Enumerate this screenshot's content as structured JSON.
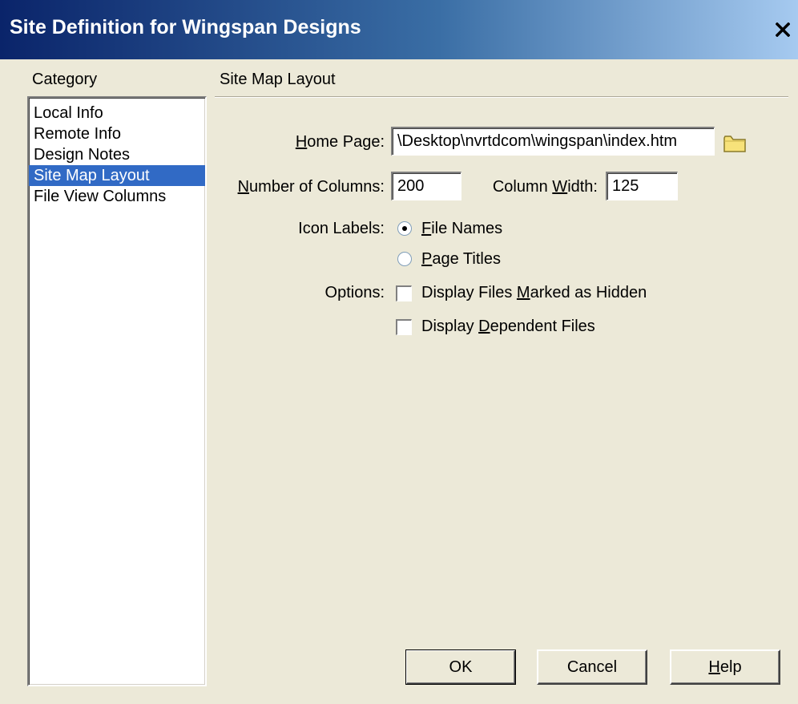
{
  "window": {
    "title": "Site Definition for Wingspan Designs",
    "close_icon": "close-icon"
  },
  "category": {
    "label": "Category",
    "items": [
      {
        "label": "Local Info",
        "selected": false
      },
      {
        "label": "Remote Info",
        "selected": false
      },
      {
        "label": "Design Notes",
        "selected": false
      },
      {
        "label": "Site Map Layout",
        "selected": true
      },
      {
        "label": "File View Columns",
        "selected": false
      }
    ]
  },
  "panel": {
    "title": "Site Map Layout",
    "home_page": {
      "label_prefix": "",
      "label_key": "H",
      "label_rest": "ome Page:",
      "value": "\\Desktop\\nvrtdcom\\wingspan\\index.htm",
      "browse_icon": "folder-icon"
    },
    "num_columns": {
      "label_key": "N",
      "label_rest": "umber of Columns:",
      "value": "200"
    },
    "column_width": {
      "label_prefix": "Column ",
      "label_key": "W",
      "label_rest": "idth:",
      "value": "125"
    },
    "icon_labels": {
      "label": "Icon Labels:",
      "options": [
        {
          "key": "F",
          "rest": "ile Names",
          "checked": true
        },
        {
          "key": "P",
          "rest": "age Titles",
          "checked": false
        }
      ]
    },
    "options": {
      "label": "Options:",
      "items": [
        {
          "prefix": "Display Files ",
          "key": "M",
          "rest": "arked as Hidden",
          "checked": false
        },
        {
          "prefix": "Display ",
          "key": "D",
          "rest": "ependent Files",
          "checked": false
        }
      ]
    }
  },
  "buttons": {
    "ok": "OK",
    "cancel": "Cancel",
    "help_key": "H",
    "help_rest": "elp"
  },
  "colors": {
    "selection": "#316ac5",
    "titlebar_start": "#0a246a",
    "dialog_bg": "#ece9d8"
  }
}
